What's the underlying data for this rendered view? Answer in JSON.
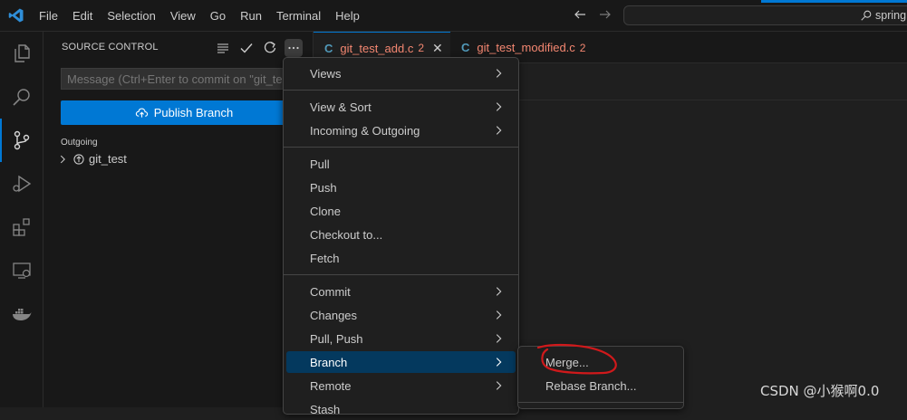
{
  "titlebar": {
    "menu": [
      "File",
      "Edit",
      "Selection",
      "View",
      "Go",
      "Run",
      "Terminal",
      "Help"
    ],
    "search_text": "spring"
  },
  "sidebar": {
    "title": "SOURCE CONTROL",
    "commit_placeholder": "Message (Ctrl+Enter to commit on \"git_te",
    "publish_label": "Publish Branch",
    "outgoing_label": "Outgoing",
    "tree_item": "git_test"
  },
  "tabs": [
    {
      "name": "git_test_add.c",
      "badge": "2",
      "icon": "C"
    },
    {
      "name": "git_test_modified.c",
      "badge": "2",
      "icon": "C"
    }
  ],
  "menu": {
    "views": "Views",
    "view_sort": "View & Sort",
    "incoming_outgoing": "Incoming & Outgoing",
    "pull": "Pull",
    "push": "Push",
    "clone": "Clone",
    "checkout": "Checkout to...",
    "fetch": "Fetch",
    "commit": "Commit",
    "changes": "Changes",
    "pull_push": "Pull, Push",
    "branch": "Branch",
    "remote": "Remote",
    "stash": "Stash"
  },
  "submenu": {
    "merge": "Merge...",
    "rebase": "Rebase Branch..."
  },
  "watermark": "CSDN @小猴啊0.0",
  "colors": {
    "accent": "#0078d4",
    "menu_selected": "#04395e",
    "error_text": "#f48771",
    "annotation": "#d0191b"
  }
}
